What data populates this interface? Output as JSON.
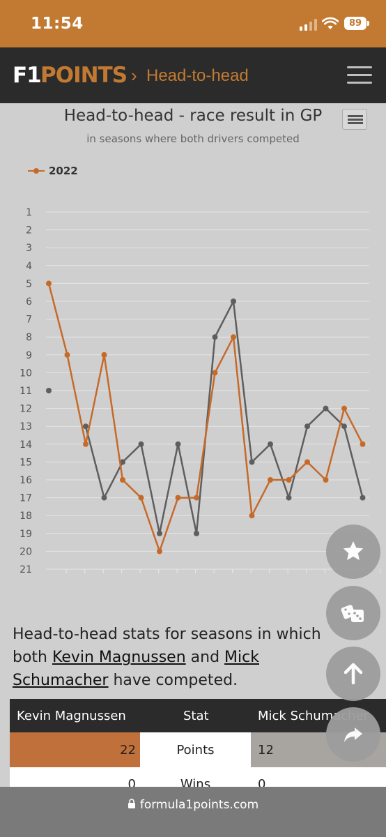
{
  "status_bar": {
    "time": "11:54",
    "battery": "89"
  },
  "header": {
    "logo_f1": "F1",
    "logo_points": "POINTS",
    "breadcrumb_separator": "›",
    "breadcrumb": "Head-to-head"
  },
  "chart_data": {
    "type": "line",
    "title": "Head-to-head - race result in GP",
    "subtitle": "in seasons where both drivers competed",
    "legend": [
      {
        "name": "2022",
        "color": "#c66a2a"
      }
    ],
    "y_ticks": [
      "1",
      "2",
      "3",
      "4",
      "5",
      "6",
      "7",
      "8",
      "9",
      "10",
      "11",
      "12",
      "13",
      "14",
      "15",
      "16",
      "17",
      "18",
      "19",
      "20",
      "21"
    ],
    "ylim": [
      1,
      21
    ],
    "y_reversed": true,
    "series": [
      {
        "name": "2022",
        "color": "#c66a2a",
        "values": [
          5,
          9,
          14,
          9,
          16,
          17,
          20,
          17,
          17,
          10,
          8,
          18,
          16,
          16,
          15,
          16,
          12,
          14
        ]
      },
      {
        "color": "#5e5e5e",
        "values": [
          11,
          null,
          13,
          17,
          15,
          14,
          19,
          14,
          19,
          8,
          6,
          15,
          14,
          17,
          13,
          12,
          13,
          17
        ]
      }
    ]
  },
  "content": {
    "intro_1": "Head-to-head stats for seasons in which both ",
    "driver1": "Kevin Magnussen",
    "intro_2": " and ",
    "driver2": "Mick Schumacher",
    "intro_3": " have competed."
  },
  "table": {
    "headers": [
      "Kevin Magnussen",
      "Stat",
      "Mick Schumacher"
    ],
    "rows": [
      {
        "left": "22",
        "stat": "Points",
        "right": "12"
      },
      {
        "left": "0",
        "stat": "Wins",
        "right": "0"
      }
    ],
    "colors": {
      "left": "#c0703a",
      "right": "#a8a4a0"
    }
  },
  "fabs": [
    "star-icon",
    "dice-icon",
    "arrow-up-icon",
    "share-icon"
  ],
  "url_bar": {
    "domain": "formula1points.com"
  }
}
